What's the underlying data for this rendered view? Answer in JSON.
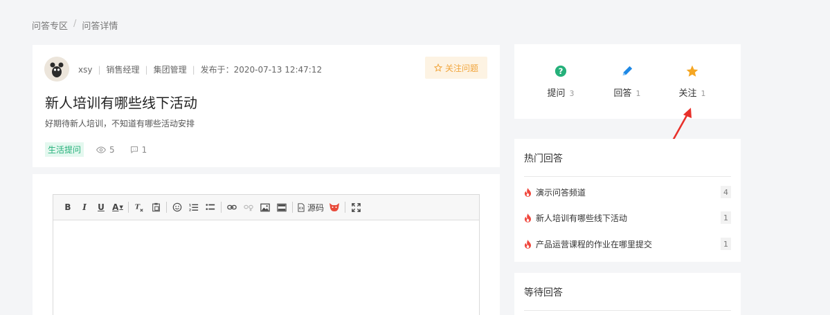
{
  "breadcrumb": {
    "root": "问答专区",
    "separator": "/",
    "current": "问答详情"
  },
  "question": {
    "author": "xsy",
    "position": "销售经理",
    "department": "集团管理",
    "published": "发布于：2020-07-13 12:47:12",
    "follow_label": "关注问题",
    "title": "新人培训有哪些线下活动",
    "description": "好期待新人培训，不知道有哪些活动安排",
    "tag": "生活提问",
    "views": "5",
    "comments": "1"
  },
  "editor": {
    "toolbar": {
      "bold": "B",
      "italic": "I",
      "underline": "U",
      "font_color": "A",
      "source": "源码"
    },
    "icons": [
      "bold-icon",
      "italic-icon",
      "underline-icon",
      "font-color-icon",
      "clear-format-icon",
      "paste-icon",
      "emoji-icon",
      "ordered-list-icon",
      "unordered-list-icon",
      "link-icon",
      "unlink-icon",
      "image-icon",
      "video-icon",
      "source-icon",
      "plugin-icon",
      "fullscreen-icon"
    ]
  },
  "stats": [
    {
      "label": "提问",
      "count": "3",
      "icon": "question-icon",
      "color": "#25b07a"
    },
    {
      "label": "回答",
      "count": "1",
      "icon": "pencil-icon",
      "color": "#1e88e5"
    },
    {
      "label": "关注",
      "count": "1",
      "icon": "star-icon",
      "color": "#f5a623"
    }
  ],
  "hot_answers": {
    "title": "热门回答",
    "items": [
      {
        "title": "演示问答频道",
        "count": "4"
      },
      {
        "title": "新人培训有哪些线下活动",
        "count": "1"
      },
      {
        "title": "产品运营课程的作业在哪里提交",
        "count": "1"
      }
    ]
  },
  "waiting": {
    "title": "等待回答"
  },
  "colors": {
    "accent_orange": "#f1a53c",
    "tag_green": "#25b07a",
    "fire_red": "#f0483e",
    "arrow_red": "#e8302a"
  }
}
